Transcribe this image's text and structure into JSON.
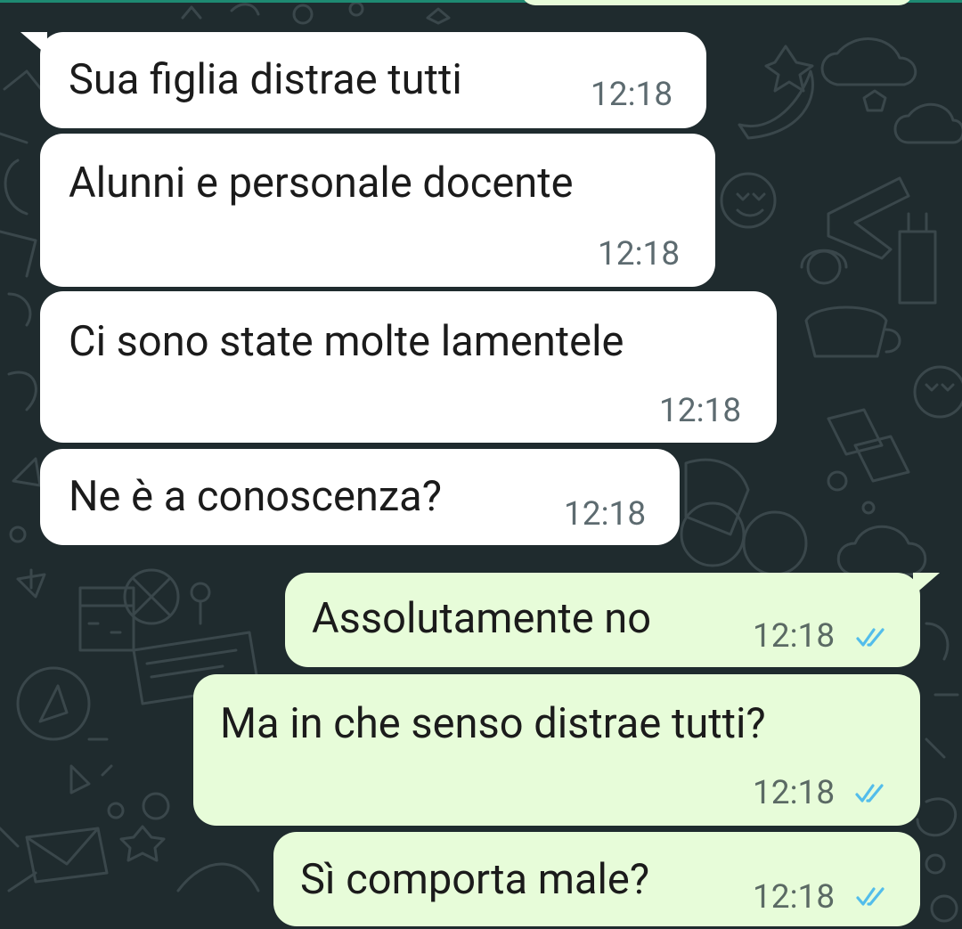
{
  "conversation": {
    "messages": [
      {
        "direction": "incoming",
        "text": "Sua figlia distrae tutti",
        "time": "12:18"
      },
      {
        "direction": "incoming",
        "text": "Alunni e personale docente",
        "time": "12:18"
      },
      {
        "direction": "incoming",
        "text": "Ci sono state molte lamentele",
        "time": "12:18"
      },
      {
        "direction": "incoming",
        "text": "Ne è a conoscenza?",
        "time": "12:18"
      },
      {
        "direction": "outgoing",
        "text": "Assolutamente no",
        "time": "12:18",
        "status": "read"
      },
      {
        "direction": "outgoing",
        "text": "Ma in che senso distrae tutti?",
        "time": "12:18",
        "status": "read"
      },
      {
        "direction": "outgoing",
        "text": "Sì comporta male?",
        "time": "12:18",
        "status": "read"
      }
    ]
  },
  "colors": {
    "background": "#1f2b2e",
    "incoming_bubble": "#ffffff",
    "outgoing_bubble": "#e7fcd9",
    "read_ticks": "#53bdeb"
  },
  "icons": {
    "read_receipt": "double-check-icon"
  }
}
